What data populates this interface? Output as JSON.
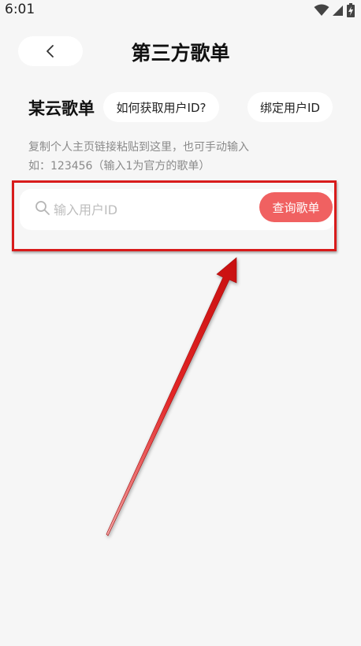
{
  "status_bar": {
    "time": "6:01"
  },
  "header": {
    "title": "第三方歌单"
  },
  "section": {
    "title": "某云歌单",
    "how_to_get_id": "如何获取用户ID?",
    "bind_user_id": "绑定用户ID"
  },
  "hint": {
    "line1": "复制个人主页链接粘贴到这里，也可手动输入",
    "line2": "如：123456（输入1为官方的歌单）"
  },
  "search": {
    "placeholder": "输入用户ID",
    "value": "",
    "button_label": "查询歌单"
  },
  "colors": {
    "accent_button": "#f06161",
    "highlight_red": "#d81b1b",
    "background": "#f6f6f6"
  },
  "icons": [
    "back-chevron-icon",
    "wifi-icon",
    "signal-icon",
    "battery-charging-icon",
    "search-icon",
    "arrow-annotation"
  ]
}
